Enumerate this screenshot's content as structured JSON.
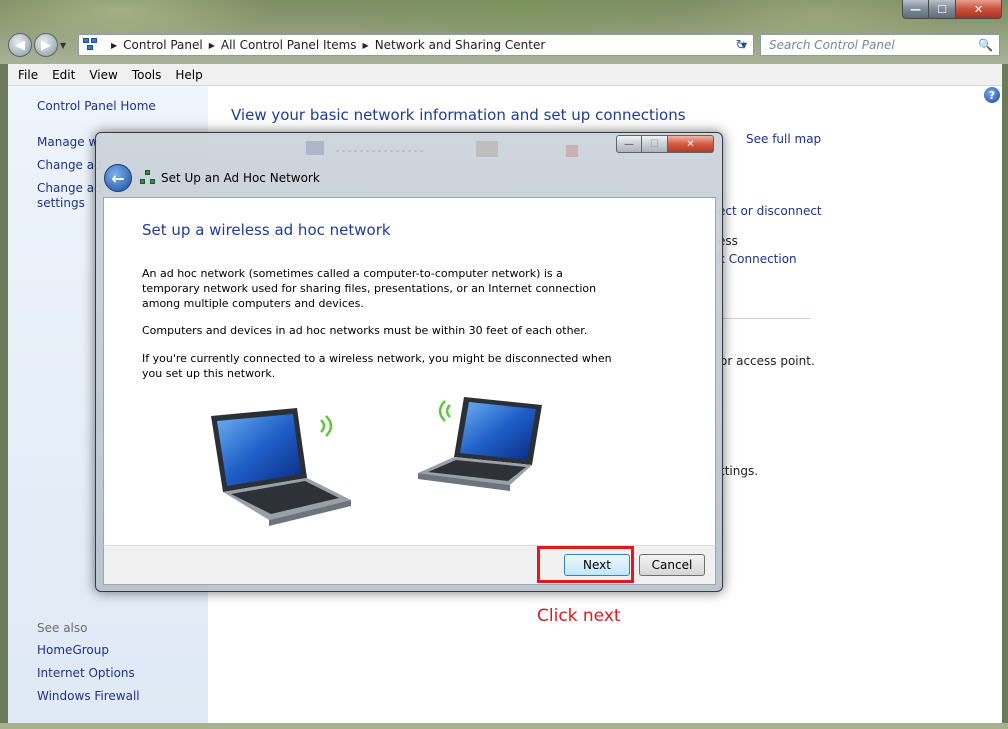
{
  "window": {
    "caption_min": "—",
    "caption_max": "☐",
    "caption_close": "✕"
  },
  "nav": {
    "back_glyph": "◀",
    "forward_glyph": "▶",
    "dropdown_glyph": "▼",
    "refresh_glyph": "↻",
    "breadcrumb": [
      "Control Panel",
      "All Control Panel Items",
      "Network and Sharing Center"
    ],
    "search_placeholder": "Search Control Panel",
    "search_icon": "🔍"
  },
  "menu": [
    "File",
    "Edit",
    "View",
    "Tools",
    "Help"
  ],
  "sidebar": {
    "home": "Control Panel Home",
    "items": [
      "Manage wi",
      "Change ad",
      "Change ad",
      "settings"
    ],
    "see_also_label": "See also",
    "see_also": [
      "HomeGroup",
      "Internet Options",
      "Windows Firewall"
    ]
  },
  "main": {
    "heading": "View your basic network information and set up connections",
    "help_glyph": "?",
    "see_full_map": "See full map",
    "connect_disconnect": "ect or disconnect",
    "access_frag": "ess",
    "connection_frag": "k Connection",
    "access_point_frag": "or access point.",
    "settings_frag": "ttings."
  },
  "dialog": {
    "window_title": "Set Up an Ad Hoc Network",
    "back_glyph": "←",
    "min_glyph": "—",
    "max_glyph": "☐",
    "close_glyph": "✕",
    "heading": "Set up a wireless ad hoc network",
    "para1": "An ad hoc network (sometimes called a computer-to-computer network) is a temporary network used for sharing files, presentations, or an Internet connection among multiple computers and devices.",
    "para2": "Computers and devices in ad hoc networks must be within 30 feet of each other.",
    "para3": "If you're currently connected to a wireless network, you might be disconnected when you set up this network.",
    "next_label": "Next",
    "cancel_label": "Cancel"
  },
  "annotation": {
    "text": "Click next",
    "color": "#e0191e"
  },
  "colors": {
    "link": "#1e3287",
    "heading": "#1e3c96",
    "sidebar_bg": "#dfe9f5"
  }
}
